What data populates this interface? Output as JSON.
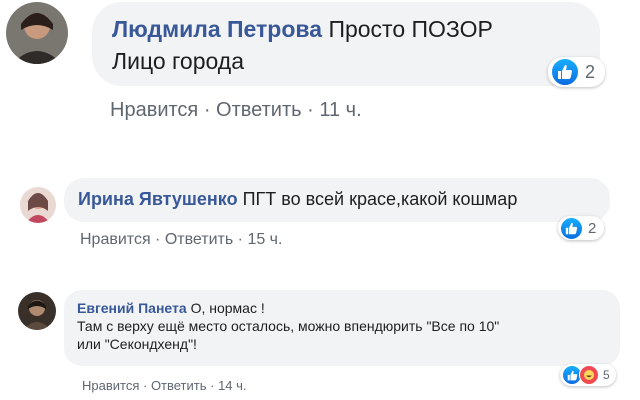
{
  "comments": [
    {
      "author": "Людмила Петрова",
      "text_line1": "Просто ПОЗОР",
      "text_line2": "Лицо города",
      "reaction_count": "2",
      "actions": {
        "like": "Нравится",
        "reply": "Ответить",
        "time": "11 ч."
      },
      "avatar_colors": [
        "#3a2f2a",
        "#8b5a3c"
      ]
    },
    {
      "author": "Ирина Явтушенко",
      "text_line1": "ПГТ во всей красе,какой кошмар",
      "reaction_count": "2",
      "actions": {
        "like": "Нравится",
        "reply": "Ответить",
        "time": "15 ч."
      },
      "avatar_colors": [
        "#e9d6cf",
        "#6d4a45"
      ]
    },
    {
      "author": "Евгений Панета",
      "text_line1": "О, нормас !",
      "text_line2": "Там с верху ещё место осталось, можно впендюрить \"Все по 10\"",
      "text_line3": "или \"Секондхенд\"!",
      "reaction_count": "5",
      "actions": {
        "like": "Нравится",
        "reply": "Ответить",
        "time": "14 ч."
      },
      "avatar_colors": [
        "#2c2420",
        "#b08a6e"
      ]
    }
  ],
  "separator": " · ",
  "colors": {
    "author": "#385898",
    "bubble": "#f2f3f5",
    "meta": "#606770",
    "like": "#1877f2",
    "haha": "#f24a52"
  }
}
